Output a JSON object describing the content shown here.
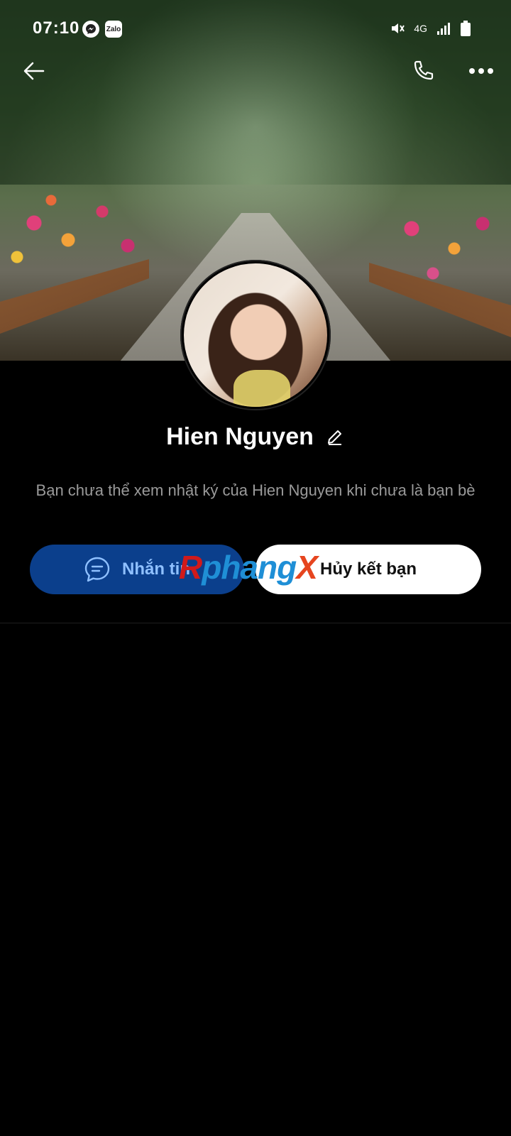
{
  "status_bar": {
    "time": "07:10",
    "apps": [
      {
        "icon": "messenger-icon",
        "label": ""
      },
      {
        "icon": "zalo-icon",
        "label": "Zalo"
      }
    ],
    "network": "4G"
  },
  "header": {
    "back_icon": "arrow-left-icon",
    "call_icon": "phone-icon",
    "more_icon": "more-dots-icon"
  },
  "profile": {
    "name": "Hien Nguyen",
    "notice": "Bạn chưa thể xem nhật ký của Hien Nguyen khi chưa là bạn bè"
  },
  "actions": {
    "message_label": "Nhắn tin",
    "unfriend_label": "Hủy kết bạn"
  },
  "watermark": {
    "part1": "R",
    "part2": "phang",
    "part3": "X"
  },
  "colors": {
    "background": "#000000",
    "message_button": "#0b3f8c",
    "message_text": "#8fc0ff",
    "unfriend_button": "#ffffff",
    "notice_text": "#9a9a9a"
  }
}
